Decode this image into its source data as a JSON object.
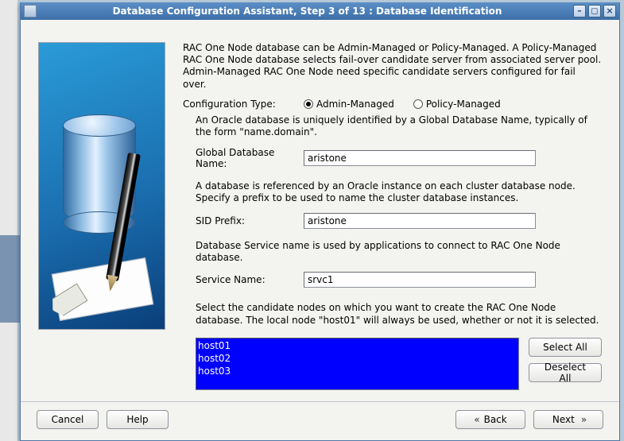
{
  "window": {
    "title": "Database Configuration Assistant, Step 3 of 13 : Database Identification"
  },
  "intro": "RAC One Node database can be Admin-Managed or Policy-Managed. A Policy-Managed RAC One Node database selects fail-over candidate server from associated server pool. Admin-Managed RAC One Node need specific candidate servers configured for fail over.",
  "config_type": {
    "label": "Configuration Type:",
    "options": {
      "admin": "Admin-Managed",
      "policy": "Policy-Managed"
    },
    "selected": "admin"
  },
  "gdb": {
    "desc": "An Oracle database is uniquely identified by a Global Database Name, typically of the form \"name.domain\".",
    "label": "Global Database Name:",
    "value": "aristone"
  },
  "sid": {
    "desc": "A database is referenced by an Oracle instance on each cluster database node. Specify a prefix to be used to name the cluster database instances.",
    "label": "SID Prefix:",
    "value": "aristone"
  },
  "service": {
    "desc": "Database Service name is used by applications to connect to RAC One Node database.",
    "label": "Service Name:",
    "value": "srvc1"
  },
  "nodes": {
    "desc": "Select the candidate nodes on which you want to create the RAC One Node database. The local node \"host01\" will always be used, whether or not it is selected.",
    "items": [
      "host01",
      "host02",
      "host03"
    ],
    "select_all": "Select All",
    "deselect_all": "Deselect All"
  },
  "footer": {
    "cancel": "Cancel",
    "help": "Help",
    "back": "Back",
    "next": "Next"
  }
}
